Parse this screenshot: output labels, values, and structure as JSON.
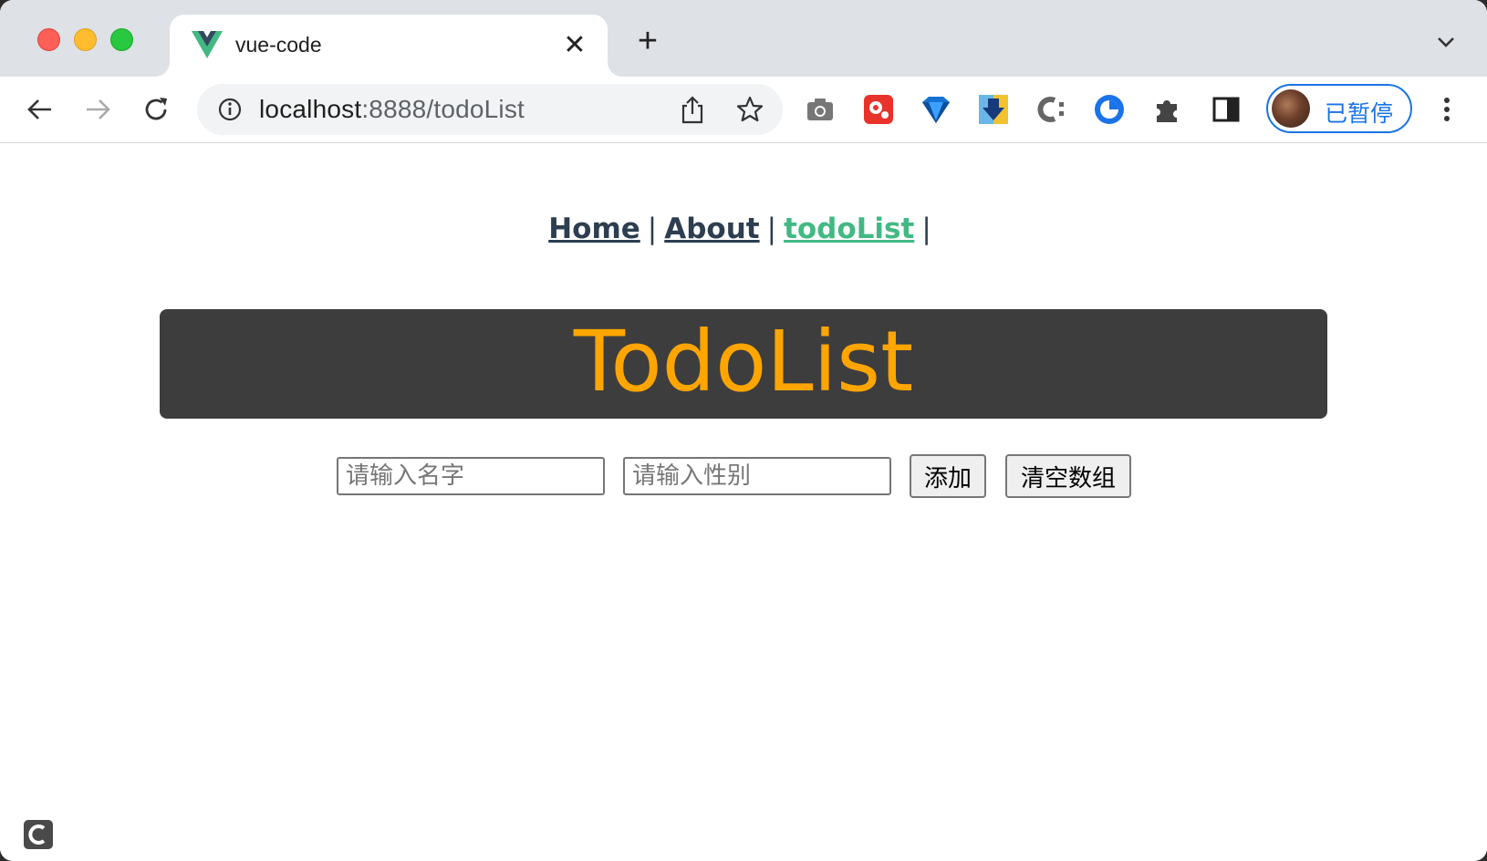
{
  "browser": {
    "tab": {
      "title": "vue-code",
      "close_glyph": "✕"
    },
    "new_tab_glyph": "+",
    "url": {
      "host": "localhost",
      "rest": ":8888/todoList"
    },
    "profile": {
      "label": "已暂停"
    },
    "extensions": [
      "camera-icon",
      "red-gear-extension-icon",
      "blue-gem-extension-icon",
      "download-extension-icon",
      "c-extension-icon",
      "blue-circle-extension-icon",
      "puzzle-icon",
      "sidepanel-icon"
    ]
  },
  "nav": {
    "home": "Home",
    "about": "About",
    "todolist": "todoList",
    "separator": "|"
  },
  "banner": {
    "title": "TodoList"
  },
  "form": {
    "name_placeholder": "请输入名字",
    "gender_placeholder": "请输入性别",
    "add_label": "添加",
    "clear_label": "清空数组"
  },
  "colors": {
    "vue_green": "#42b983",
    "nav_dark": "#2c3e50",
    "banner_bg": "#3d3d3d",
    "banner_text": "#ffa500",
    "accent_blue": "#1a73e8"
  }
}
